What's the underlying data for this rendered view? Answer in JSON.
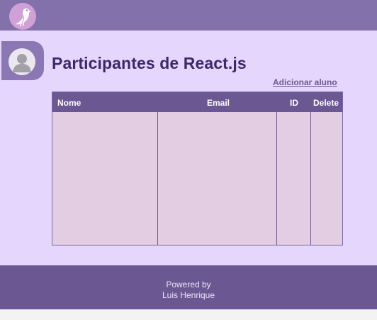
{
  "header": {
    "logo_icon": "bird-logo-icon",
    "background": "#8371ab"
  },
  "user": {
    "avatar_icon": "user-avatar-icon"
  },
  "main": {
    "title": "Participantes de React.js",
    "add_student_label": "Adicionar aluno",
    "background": "#e5d6fe"
  },
  "table": {
    "columns": [
      "Nome",
      "Email",
      "ID",
      "Delete"
    ],
    "rows": []
  },
  "footer": {
    "line1": "Powered by",
    "line2": "Luis Henrique",
    "background": "#6b5892"
  }
}
